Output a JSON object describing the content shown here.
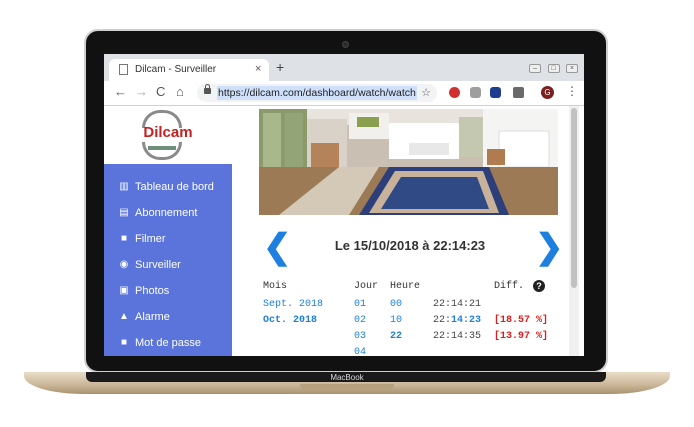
{
  "device": {
    "brand": "MacBook"
  },
  "browser": {
    "tab_title": "Dilcam - Surveiller",
    "tab_close": "×",
    "new_tab": "+",
    "url": "https://dilcam.com/dashboard/watch/watch",
    "avatar_letter": "G",
    "nav_back": "←",
    "nav_forward": "→",
    "nav_reload": "C",
    "nav_home": "⌂",
    "star": "☆",
    "menu": "⋮",
    "win_min": "–",
    "win_max": "□",
    "win_close": "×"
  },
  "sidebar": {
    "logo_text": "Dilcam",
    "items": [
      {
        "label": "Tableau de bord",
        "icon": "columns-icon",
        "glyph": "▥"
      },
      {
        "label": "Abonnement",
        "icon": "file-icon",
        "glyph": "▤"
      },
      {
        "label": "Filmer",
        "icon": "video-camera-icon",
        "glyph": "■"
      },
      {
        "label": "Surveiller",
        "icon": "eye-icon",
        "glyph": "◉"
      },
      {
        "label": "Photos",
        "icon": "image-icon",
        "glyph": "▣"
      },
      {
        "label": "Alarme",
        "icon": "warning-icon",
        "glyph": "▲"
      },
      {
        "label": "Mot de passe",
        "icon": "lock-icon",
        "glyph": "■"
      }
    ]
  },
  "viewer": {
    "prev": "❮",
    "next": "❯",
    "title": "Le 15/10/2018 à 22:14:23"
  },
  "table": {
    "headers": {
      "mois": "Mois",
      "jour": "Jour",
      "heure": "Heure",
      "diff": "Diff."
    },
    "help": "?",
    "months": [
      "Sept. 2018",
      "Oct. 2018"
    ],
    "days": [
      "01",
      "02",
      "03",
      "04"
    ],
    "hours": [
      "00",
      "10",
      "22"
    ],
    "times": [
      {
        "time": "22:14:21",
        "diff": ""
      },
      {
        "time_prefix": "22:",
        "time_main": "14:23",
        "diff": "[18.57 %]"
      },
      {
        "time": "22:14:35",
        "diff": "[13.97 %]"
      }
    ]
  },
  "colors": {
    "sidebar_bg": "#5a74dc",
    "accent_blue": "#1d7fe0",
    "diff_red": "#e01b1b",
    "logo_red": "#c22222"
  }
}
